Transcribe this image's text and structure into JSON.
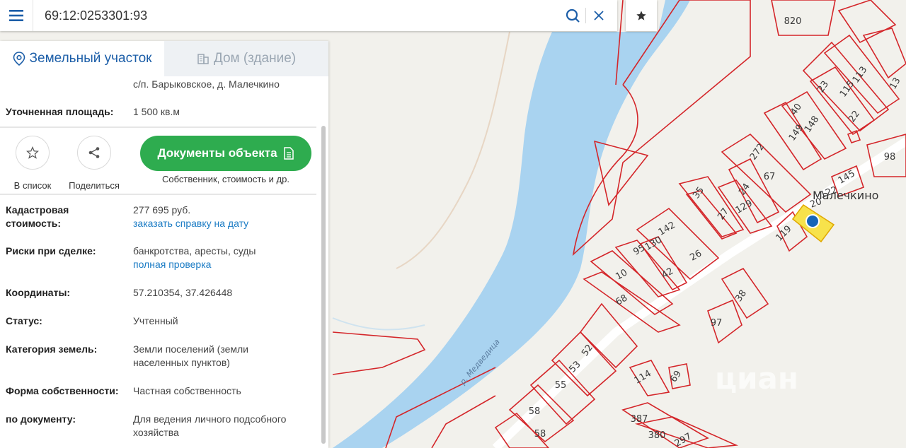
{
  "search": {
    "value": "69:12:0253301:93"
  },
  "icons": {
    "menu": "hamburger-icon",
    "search": "search-icon",
    "clear": "close-icon",
    "favorite": "star-icon"
  },
  "tabs": [
    {
      "label": "Земельный участок",
      "icon": "map-pin-icon",
      "active": true
    },
    {
      "label": "Дом (здание)",
      "icon": "building-icon",
      "active": false
    }
  ],
  "address_partial": "с/п. Барыковское, д. Малечкино",
  "area": {
    "label": "Уточненная площадь:",
    "value": "1 500 кв.м"
  },
  "actions": {
    "add_to_list": "В список",
    "share": "Поделиться",
    "documents_button": "Документы объекта",
    "documents_sub": "Собственник, стоимость и др."
  },
  "details": {
    "cadastral_label": "Кадастровая стоимость:",
    "cadastral_value": "277 695 руб.",
    "cadastral_link": "заказать справку на дату",
    "risks_label": "Риски при сделке:",
    "risks_value": "банкротства, аресты, суды",
    "risks_link": "полная проверка",
    "coords_label": "Координаты:",
    "coords_value": "57.210354, 37.426448",
    "status_label": "Статус:",
    "status_value": "Учтенный",
    "category_label": "Категория земель:",
    "category_value": "Земли поселений (земли населенных пунктов)",
    "ownership_label": "Форма собственности:",
    "ownership_value": "Частная собственность",
    "doc_label": "по документу:",
    "doc_value": "Для ведения личного подсобного хозяйства"
  },
  "map": {
    "village_label": "Малечкино",
    "river_label": "р. Медведица",
    "watermark": "циан",
    "plot_numbers": [
      "820",
      "113",
      "115",
      "13",
      "23",
      "22",
      "40",
      "148",
      "149",
      "98",
      "145",
      "122",
      "20",
      "272",
      "67",
      "24",
      "35",
      "129",
      "27",
      "119",
      "142",
      "130",
      "26",
      "95",
      "42",
      "10",
      "68",
      "38",
      "97",
      "52",
      "53",
      "55",
      "114",
      "69",
      "58",
      "58",
      "387",
      "380",
      "297"
    ],
    "colors": {
      "river": "#a9d3f0",
      "boundary": "#d4262a",
      "selected_fill": "#f7e24b",
      "marker": "#1565b8",
      "land": "#f2f1ec",
      "button_green": "#2eac4f"
    }
  }
}
